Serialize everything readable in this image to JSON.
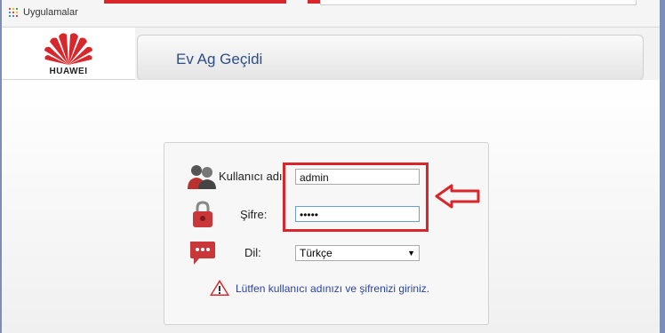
{
  "bookmarks": {
    "apps_label": "Uygulamalar",
    "apps_icon": "apps-grid-icon",
    "apps_colors": [
      "#ea4335",
      "#fbbc05",
      "#34a853",
      "#4285f4",
      "#ea4335",
      "#fbbc05",
      "#34a853",
      "#4285f4",
      "#ea4335"
    ]
  },
  "header": {
    "brand": "HUAWEI",
    "logo_icon": "huawei-logo-icon",
    "title": "Ev Ag Geçidi"
  },
  "login": {
    "username_label": "Kullanıcı adı",
    "username_value": "admin",
    "username_icon": "user-icon",
    "password_label": "Şifre:",
    "password_value": "•••••",
    "password_icon": "lock-icon",
    "language_label": "Dil:",
    "language_value": "Türkçe",
    "language_icon": "chat-icon",
    "hint_icon": "warning-icon",
    "hint": "Lütfen kullanıcı adınızı ve şifrenizi giriniz."
  },
  "annotations": {
    "highlight_color": "#d9262b",
    "arrow_icon": "left-arrow-icon"
  },
  "colors": {
    "brand_red": "#d9262b",
    "title_blue": "#2e4e86",
    "hint_blue": "#2843a8"
  }
}
